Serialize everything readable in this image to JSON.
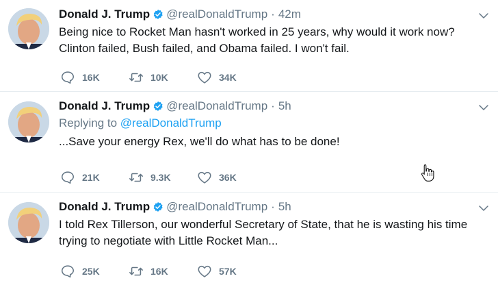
{
  "tweets": [
    {
      "name": "Donald J. Trump",
      "handle": "@realDonaldTrump",
      "separator": "·",
      "time": "42m",
      "reply_label": "",
      "reply_handle": "",
      "text": "Being nice to Rocket Man hasn't worked in 25 years, why would it work now? Clinton failed, Bush failed, and Obama failed. I won't fail.",
      "replies": "16K",
      "retweets": "10K",
      "likes": "34K"
    },
    {
      "name": "Donald J. Trump",
      "handle": "@realDonaldTrump",
      "separator": "·",
      "time": "5h",
      "reply_label": "Replying to ",
      "reply_handle": "@realDonaldTrump",
      "text": "...Save your energy Rex, we'll do what has to be done!",
      "replies": "21K",
      "retweets": "9.3K",
      "likes": "36K"
    },
    {
      "name": "Donald J. Trump",
      "handle": "@realDonaldTrump",
      "separator": "·",
      "time": "5h",
      "reply_label": "",
      "reply_handle": "",
      "text": "I told Rex Tillerson, our wonderful Secretary of State, that he is wasting his time trying to negotiate with Little Rocket Man...",
      "replies": "25K",
      "retweets": "16K",
      "likes": "57K"
    }
  ],
  "icons": {
    "verified": "verified-badge-icon",
    "caret": "chevron-down-icon",
    "reply": "reply-icon",
    "retweet": "retweet-icon",
    "like": "heart-icon",
    "cursor": "hand-pointer-icon"
  },
  "colors": {
    "name": "#14171a",
    "secondary": "#657786",
    "link": "#1da1f2",
    "divider": "#e6ecf0",
    "verified": "#1da1f2"
  }
}
